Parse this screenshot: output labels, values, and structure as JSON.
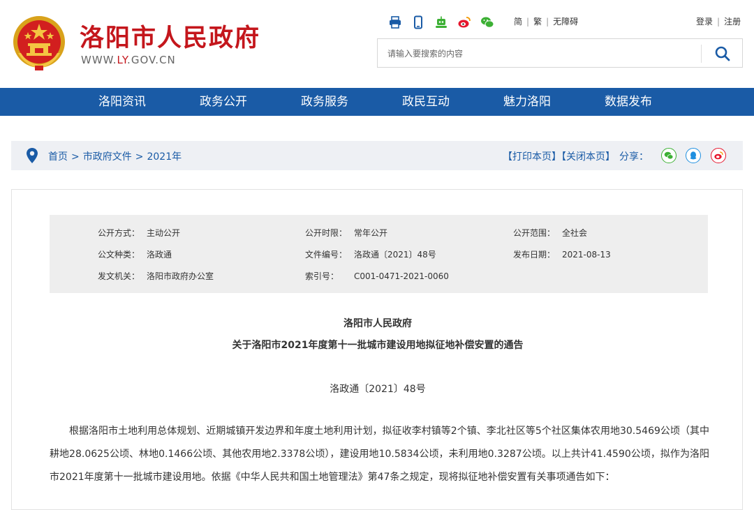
{
  "header": {
    "site_title": "洛阳市人民政府",
    "site_url_prefix": "WWW.",
    "site_url_highlight": "LY",
    "site_url_suffix": ".GOV.CN",
    "icons": [
      "print-icon",
      "mobile-icon",
      "robot-icon",
      "weibo-icon",
      "wechat-icon"
    ],
    "lang": {
      "simplified": "简",
      "traditional": "繁",
      "accessibility": "无障碍"
    },
    "auth": {
      "login": "登录",
      "register": "注册"
    },
    "search": {
      "placeholder": "请输入要搜索的内容"
    }
  },
  "nav": {
    "items": [
      "洛阳资讯",
      "政务公开",
      "政务服务",
      "政民互动",
      "魅力洛阳",
      "数据发布"
    ]
  },
  "breadcrumb": {
    "items": [
      "首页",
      "市政府文件",
      "2021年"
    ],
    "separator": ">"
  },
  "tools": {
    "print": "【打印本页】",
    "close": "【关闭本页】",
    "share_label": "分享："
  },
  "meta": {
    "row1": [
      {
        "label": "公开方式：",
        "value": "主动公开"
      },
      {
        "label": "公开时限：",
        "value": "常年公开"
      },
      {
        "label": "公开范围：",
        "value": "全社会"
      }
    ],
    "row2": [
      {
        "label": "公文种类：",
        "value": "洛政通"
      },
      {
        "label": "文件编号：",
        "value": "洛政通〔2021〕48号"
      },
      {
        "label": "发布日期：",
        "value": "2021-08-13"
      }
    ],
    "row3": [
      {
        "label": "发文机关：",
        "value": "洛阳市政府办公室"
      },
      {
        "label": "索引号：",
        "value": "C001-0471-2021-0060"
      }
    ]
  },
  "document": {
    "issuer": "洛阳市人民政府",
    "title": "关于洛阳市2021年度第十一批城市建设用地拟征地补偿安置的通告",
    "number": "洛政通〔2021〕48号",
    "body": "根据洛阳市土地利用总体规划、近期城镇开发边界和年度土地利用计划，拟征收李村镇等2个镇、李北社区等5个社区集体农用地30.5469公顷（其中耕地28.0625公顷、林地0.1466公顷、其他农用地2.3378公顷），建设用地10.5834公顷，未利用地0.3287公顷。以上共计41.4590公顷，拟作为洛阳市2021年度第十一批城市建设用地。依据《中华人民共和国土地管理法》第47条之规定，现将拟征地补偿安置有关事项通告如下："
  },
  "colors": {
    "brand_red": "#c4161c",
    "nav_blue": "#1a5ba6",
    "wechat_green": "#3cb034",
    "qq_blue": "#1e8fe0",
    "weibo_red": "#e6162d"
  }
}
